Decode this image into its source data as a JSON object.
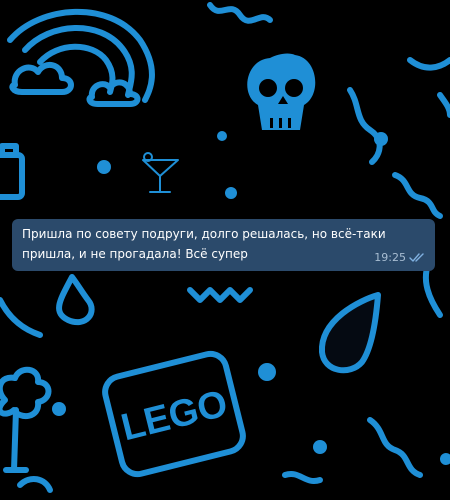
{
  "message": {
    "text": "Пришла по совету подруги, долго решалась, но всё-таки пришла, и не прогадала! Всё супер",
    "time": "19:25",
    "status_icon": "double-check-icon"
  },
  "wallpaper": {
    "accent_color": "#1f8fd6",
    "logo_text": "LEGO"
  },
  "colors": {
    "background": "#000000",
    "bubble": "#2b4a6b",
    "text": "#ffffff",
    "time": "#a8bdd2"
  }
}
